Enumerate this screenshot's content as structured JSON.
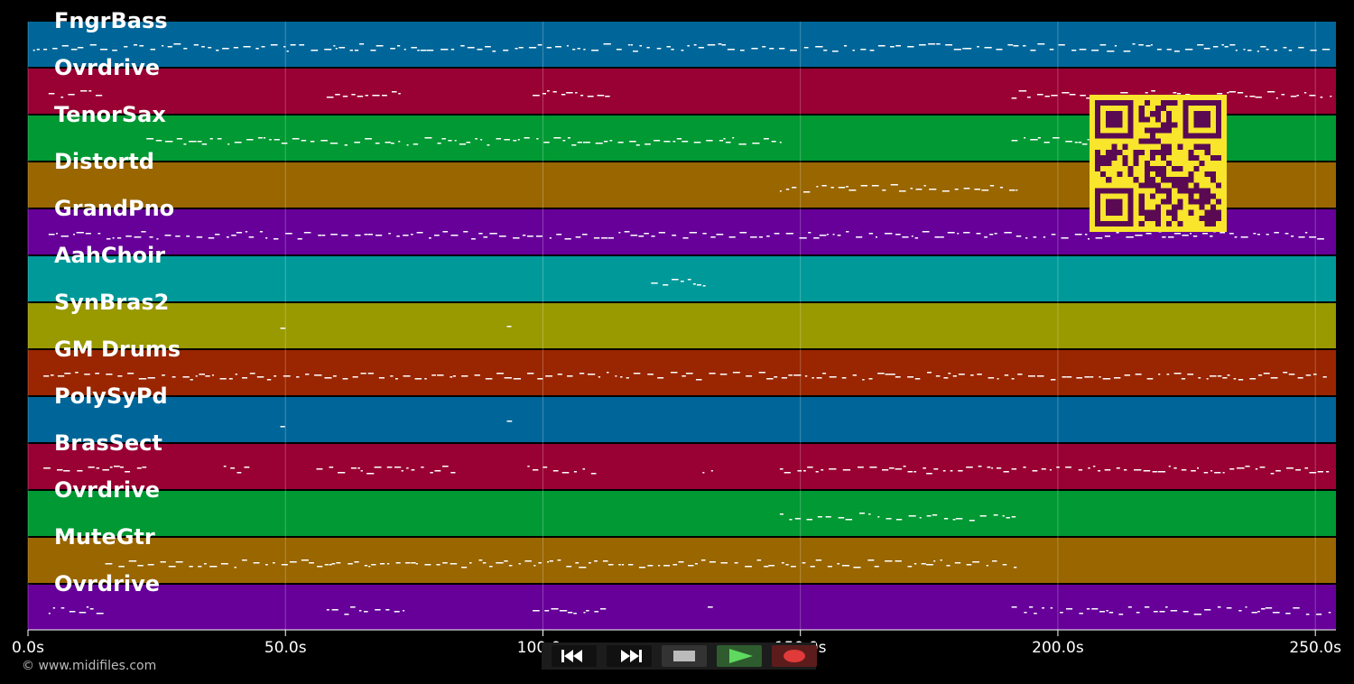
{
  "app": {
    "copyright": "© www.midifiles.com"
  },
  "tracks": [
    {
      "label": "FngrBass",
      "color": "#006699"
    },
    {
      "label": "Ovrdrive",
      "color": "#990033"
    },
    {
      "label": "TenorSax",
      "color": "#009933"
    },
    {
      "label": "Distortd",
      "color": "#996600"
    },
    {
      "label": "GrandPno",
      "color": "#660099"
    },
    {
      "label": "AahChoir",
      "color": "#009999"
    },
    {
      "label": "SynBras2",
      "color": "#999900"
    },
    {
      "label": "GM Drums",
      "color": "#992600"
    },
    {
      "label": "PolySyPd",
      "color": "#006699"
    },
    {
      "label": "BrasSect",
      "color": "#990033"
    },
    {
      "label": "Ovrdrive",
      "color": "#009933"
    },
    {
      "label": "MuteGtr",
      "color": "#996600"
    },
    {
      "label": "Ovrdrive",
      "color": "#660099"
    }
  ],
  "timeline": {
    "unit": "s",
    "max_seconds": 254,
    "ticks": [
      {
        "seconds": 0,
        "label": "0.0s"
      },
      {
        "seconds": 50,
        "label": "50.0s"
      },
      {
        "seconds": 100,
        "label": "100.0s"
      },
      {
        "seconds": 150,
        "label": "150.0s"
      },
      {
        "seconds": 200,
        "label": "200.0s"
      },
      {
        "seconds": 250,
        "label": "250.0s"
      }
    ]
  },
  "transport": {
    "buttons": [
      {
        "name": "rewind-button",
        "icon": "rewind-icon",
        "bg": "#111111"
      },
      {
        "name": "fast-forward-button",
        "icon": "fast-forward-icon",
        "bg": "#111111"
      },
      {
        "name": "stop-button",
        "icon": "stop-icon",
        "bg": "#333333"
      },
      {
        "name": "play-button",
        "icon": "play-icon",
        "bg": "#2e5c2e"
      },
      {
        "name": "record-button",
        "icon": "record-icon",
        "bg": "#5c1c1c"
      }
    ]
  },
  "note_activity": [
    [
      [
        1,
        253
      ]
    ],
    [
      [
        4,
        15
      ],
      [
        58,
        73
      ],
      [
        98,
        113
      ],
      [
        191,
        253
      ]
    ],
    [
      [
        23,
        146
      ],
      [
        191,
        206
      ]
    ],
    [
      [
        146,
        192
      ]
    ],
    [
      [
        4,
        253
      ]
    ],
    [
      [
        121,
        132
      ]
    ],
    [
      [
        49,
        50
      ],
      [
        93,
        94
      ]
    ],
    [
      [
        3,
        253
      ]
    ],
    [
      [
        49,
        50
      ],
      [
        93,
        94
      ]
    ],
    [
      [
        3,
        23
      ],
      [
        38,
        43
      ],
      [
        56,
        83
      ],
      [
        97,
        111
      ],
      [
        131,
        133
      ],
      [
        146,
        253
      ]
    ],
    [
      [
        146,
        192
      ]
    ],
    [
      [
        15,
        192
      ]
    ],
    [
      [
        4,
        15
      ],
      [
        58,
        73
      ],
      [
        98,
        113
      ],
      [
        132,
        133
      ],
      [
        191,
        253
      ]
    ]
  ]
}
